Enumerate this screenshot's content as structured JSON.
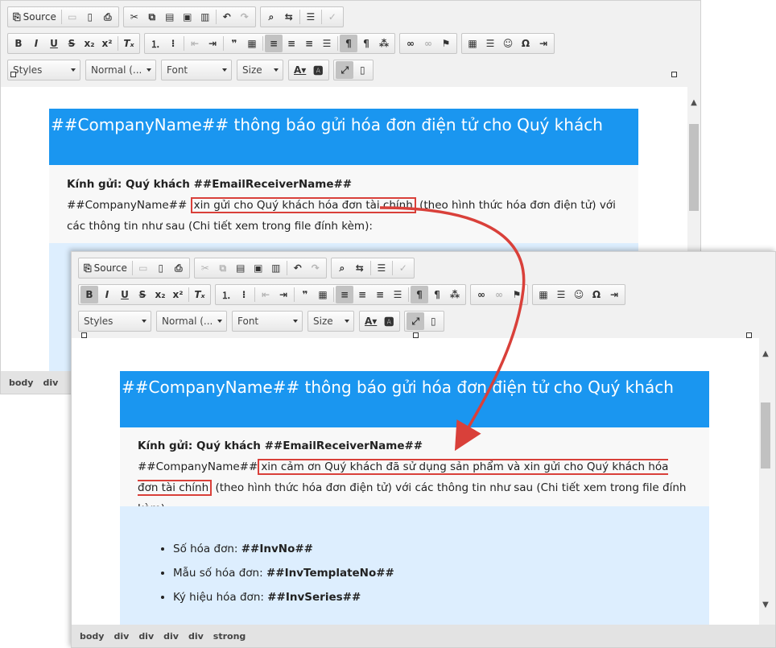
{
  "toolbar": {
    "source_label": "Source",
    "styles_label": "Styles",
    "format_label": "Normal (...",
    "font_label": "Font",
    "size_label": "Size"
  },
  "email": {
    "header_title": "##CompanyName## thông báo gửi hóa đơn điện tử cho Quý khách",
    "greeting": "Kính gửi: Quý khách ##EmailReceiverName##",
    "company_placeholder": "##CompanyName##",
    "before": {
      "highlighted": "xin gửi cho Quý khách hóa đơn tài chính",
      "rest": "(theo hình thức hóa đơn điện tử) với các thông tin như sau (Chi tiết xem trong file đính kèm):"
    },
    "after": {
      "highlighted": "xin cảm ơn Quý khách đã sử dụng sản phẩm và xin gửi cho Quý khách hóa đơn tài chính",
      "rest": "(theo hình thức hóa đơn điện tử) với các thông tin như sau (Chi tiết xem trong file đính kèm):"
    },
    "invoice_items": [
      {
        "label": "Số hóa đơn:",
        "value": "##InvNo##"
      },
      {
        "label": "Mẫu số hóa đơn:",
        "value": "##InvTemplateNo##"
      },
      {
        "label": "Ký hiệu hóa đơn:",
        "value": "##InvSeries##"
      }
    ]
  },
  "statusbar": {
    "back_path": [
      "body",
      "div"
    ],
    "front_path": [
      "body",
      "div",
      "div",
      "div",
      "div",
      "strong"
    ]
  },
  "colors": {
    "header_bg": "#1a96f0",
    "highlight_border": "#d9403a",
    "info_bg": "#ddeefe"
  }
}
